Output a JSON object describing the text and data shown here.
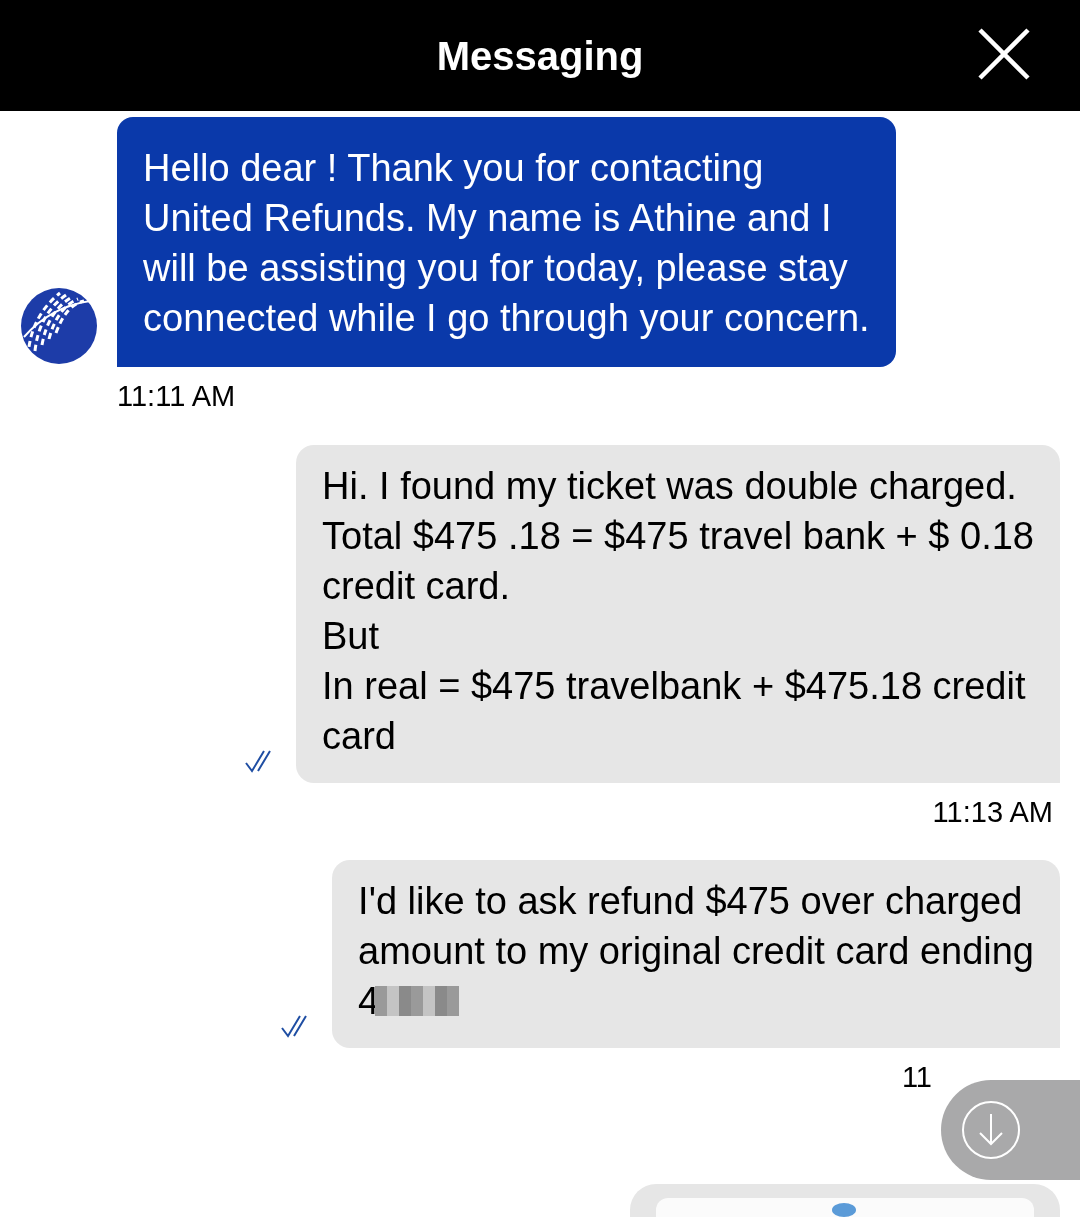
{
  "header": {
    "title": "Messaging"
  },
  "messages": [
    {
      "kind": "agent",
      "text": "Hello dear ! Thank you for contacting\nUnited Refunds. My name is Athine and I\nwill be assisting you for today, please stay\nconnected while I go through your concern.",
      "time": "11:11 AM"
    },
    {
      "kind": "user",
      "read": true,
      "text": "Hi. I found my ticket was double charged.\nTotal $475 .18 = $475 travel bank + $ 0.18\ncredit card.\nBut\nIn real = $475 travelbank + $475.18 credit\ncard",
      "time": "11:13 AM"
    },
    {
      "kind": "user",
      "read": true,
      "text": "I'd like to ask refund $475 over charged\namount to my original credit card ending",
      "masked_text": "4",
      "time": "11"
    },
    {
      "kind": "attachment"
    }
  ]
}
